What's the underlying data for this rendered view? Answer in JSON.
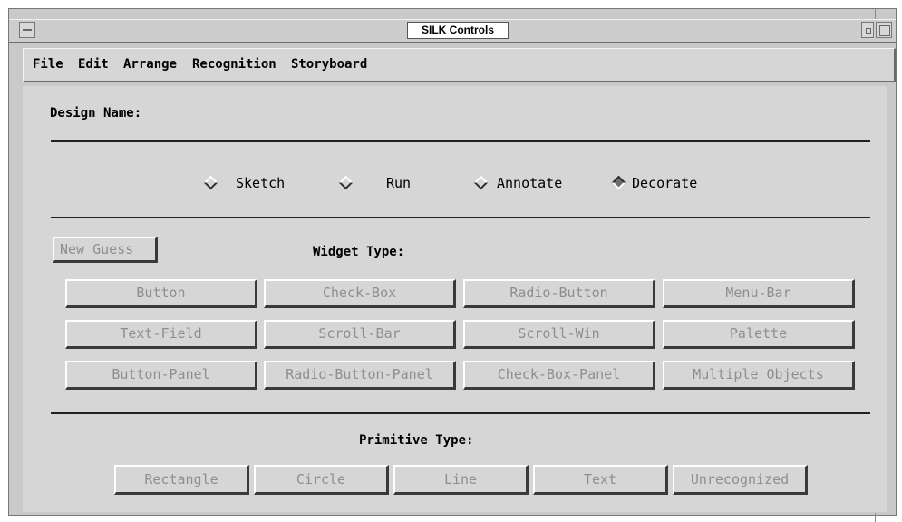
{
  "window": {
    "title": "SILK Controls"
  },
  "menu": [
    "File",
    "Edit",
    "Arrange",
    "Recognition",
    "Storyboard"
  ],
  "design_name": {
    "label": "Design Name:"
  },
  "modes": {
    "items": [
      "Sketch",
      "Run",
      "Annotate",
      "Decorate"
    ],
    "selected": "Decorate"
  },
  "new_guess_label": "New Guess",
  "widget_type": {
    "label": "Widget Type:",
    "buttons": [
      "Button",
      "Check-Box",
      "Radio-Button",
      "Menu-Bar",
      "Text-Field",
      "Scroll-Bar",
      "Scroll-Win",
      "Palette",
      "Button-Panel",
      "Radio-Button-Panel",
      "Check-Box-Panel",
      "Multiple_Objects"
    ]
  },
  "primitive_type": {
    "label": "Primitive Type:",
    "buttons": [
      "Rectangle",
      "Circle",
      "Line",
      "Text",
      "Unrecognized"
    ]
  },
  "colors": {
    "panel": "#d6d6d6",
    "disabled_text": "#8e8e8e",
    "selected_radio": "#6e6e6e"
  }
}
